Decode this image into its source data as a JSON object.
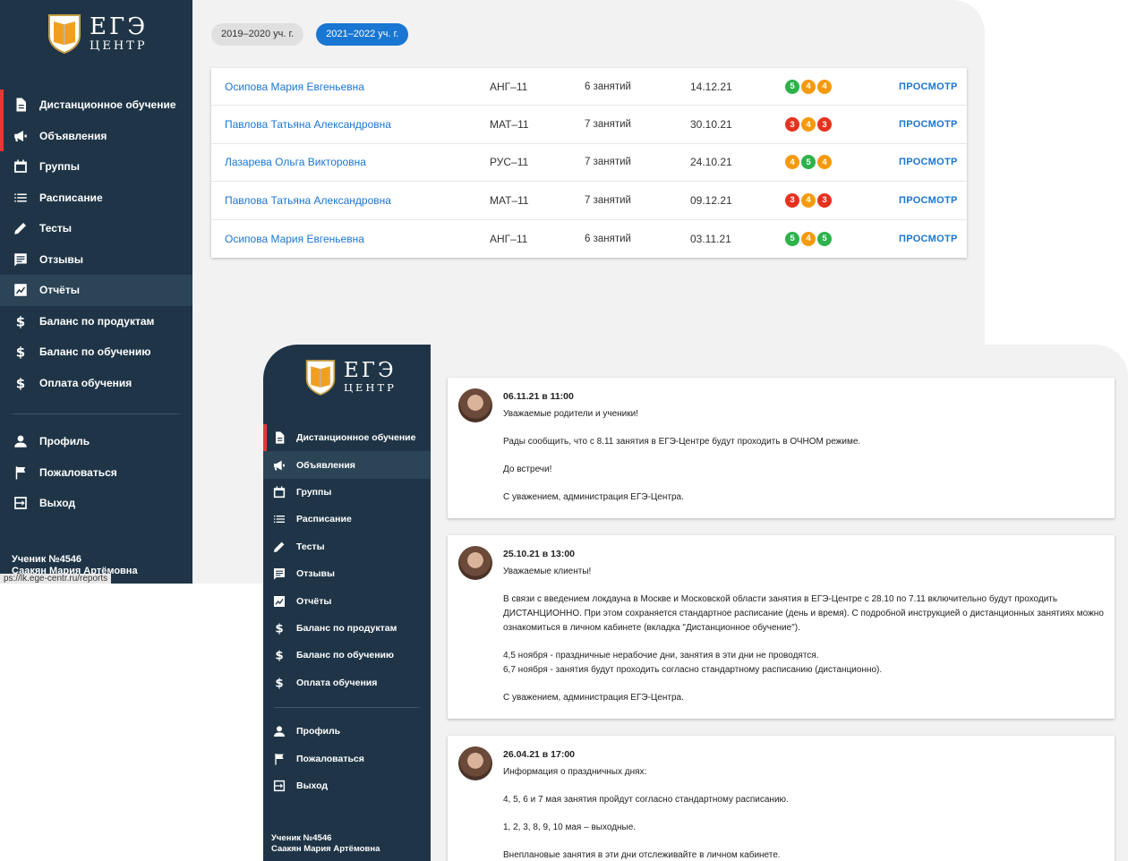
{
  "logo": {
    "main": "ЕГЭ",
    "sub": "ЦЕНТР"
  },
  "nav": [
    {
      "label": "Дистанционное обучение",
      "icon": "document-icon"
    },
    {
      "label": "Объявления",
      "icon": "megaphone-icon"
    },
    {
      "label": "Группы",
      "icon": "calendar-icon"
    },
    {
      "label": "Расписание",
      "icon": "list-icon"
    },
    {
      "label": "Тесты",
      "icon": "pencil-icon"
    },
    {
      "label": "Отзывы",
      "icon": "comment-icon"
    },
    {
      "label": "Отчёты",
      "icon": "report-icon"
    },
    {
      "label": "Баланс по продуктам",
      "icon": "dollar-icon"
    },
    {
      "label": "Баланс по обучению",
      "icon": "dollar-icon"
    },
    {
      "label": "Оплата обучения",
      "icon": "dollar-icon"
    }
  ],
  "nav_bottom": [
    {
      "label": "Профиль",
      "icon": "person-icon"
    },
    {
      "label": "Пожаловаться",
      "icon": "flag-icon"
    },
    {
      "label": "Выход",
      "icon": "exit-icon"
    }
  ],
  "student": {
    "id": "Ученик №4546",
    "name": "Саакян Мария Артёмовна"
  },
  "url_tip": "ps://lk.ege-centr.ru/reports",
  "year_tabs": [
    "2019–2020 уч. г.",
    "2021–2022 уч. г."
  ],
  "colors": {
    "sidebar": "#1f3547",
    "accent": "#1976d2",
    "grade_5": "#2db24a",
    "grade_4": "#f59a0c",
    "grade_3": "#e5321f"
  },
  "reports": [
    {
      "teacher": "Осипова Мария Евгеньевна",
      "subject": "АНГ–11",
      "lessons": "6 занятий",
      "date": "14.12.21",
      "grades": [
        "5",
        "4",
        "4"
      ],
      "action": "ПРОСМОТР"
    },
    {
      "teacher": "Павлова Татьяна Александровна",
      "subject": "МАТ–11",
      "lessons": "7 занятий",
      "date": "30.10.21",
      "grades": [
        "3",
        "4",
        "3"
      ],
      "action": "ПРОСМОТР"
    },
    {
      "teacher": "Лазарева Ольга Викторовна",
      "subject": "РУС–11",
      "lessons": "7 занятий",
      "date": "24.10.21",
      "grades": [
        "4",
        "5",
        "4"
      ],
      "action": "ПРОСМОТР"
    },
    {
      "teacher": "Павлова Татьяна Александровна",
      "subject": "МАТ–11",
      "lessons": "7 занятий",
      "date": "09.12.21",
      "grades": [
        "3",
        "4",
        "3"
      ],
      "action": "ПРОСМОТР"
    },
    {
      "teacher": "Осипова Мария Евгеньевна",
      "subject": "АНГ–11",
      "lessons": "6 занятий",
      "date": "03.11.21",
      "grades": [
        "5",
        "4",
        "5"
      ],
      "action": "ПРОСМОТР"
    }
  ],
  "announcements": [
    {
      "date": "06.11.21 в 11:00",
      "paragraphs": [
        "Уважаемые родители и ученики!",
        "Рады сообщить, что с 8.11 занятия в ЕГЭ-Центре будут проходить в ОЧНОМ режиме.",
        "До встречи!",
        "С уважением, администрация ЕГЭ-Центра."
      ]
    },
    {
      "date": "25.10.21 в 13:00",
      "paragraphs": [
        "Уважаемые клиенты!",
        "В связи с введением локдауна в Москве и Московской области занятия в ЕГЭ-Центре с 28.10 по 7.11 включительно будут проходить ДИСТАНЦИОННО. При этом сохраняется стандартное расписание (день и время). С подробной инструкцией о дистанционных занятиях можно ознакомиться в личном кабинете (вкладка \"Дистанционное обучение\").",
        "4,5 ноября - праздничные нерабочие дни, занятия в эти дни не проводятся.",
        "6,7 ноября - занятия будут проходить согласно стандартному расписанию (дистанционно).",
        "С уважением, администрация ЕГЭ-Центра."
      ]
    },
    {
      "date": "26.04.21 в 17:00",
      "paragraphs": [
        "Информация о праздничных днях:",
        "4, 5, 6 и 7 мая занятия пройдут согласно стандартному расписанию.",
        "1, 2, 3, 8, 9, 10 мая – выходные.",
        "Внеплановые занятия в эти дни отслеживайте в личном кабинете."
      ]
    }
  ]
}
